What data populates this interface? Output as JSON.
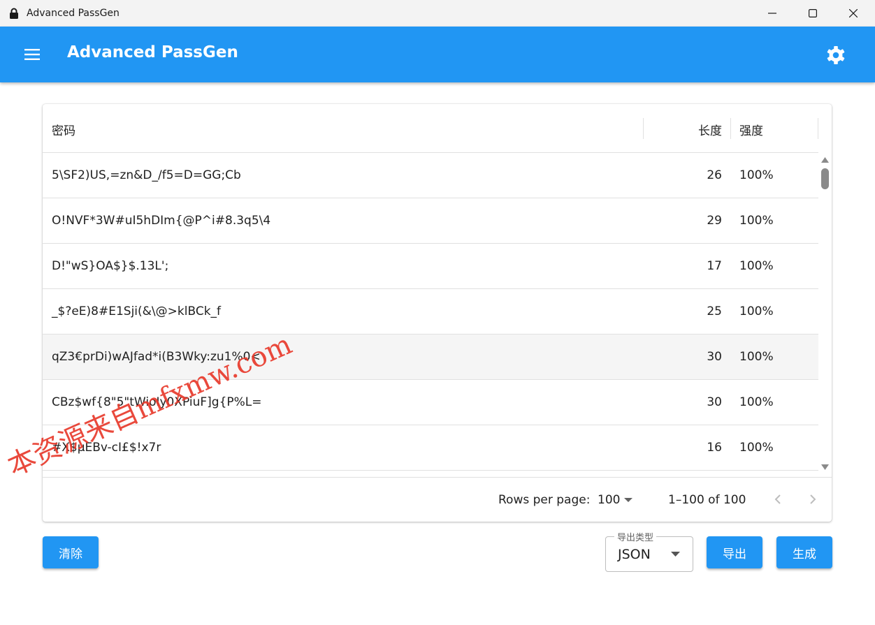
{
  "window": {
    "title": "Advanced PassGen",
    "controls": {
      "minimize": "minimize-icon",
      "maximize": "maximize-icon",
      "close": "close-icon"
    }
  },
  "appbar": {
    "title": "Advanced PassGen",
    "menu_icon": "hamburger-menu-icon",
    "settings_icon": "gear-icon",
    "color": "#2196f3"
  },
  "table": {
    "headers": {
      "password": "密码",
      "length": "长度",
      "strength": "强度"
    },
    "rows": [
      {
        "password": "5\\SF2)US,=zn&D_/f5=D=GG;Cb",
        "length": "26",
        "strength": "100%"
      },
      {
        "password": "O!NVF*3W#uI5hDIm{@P^i#8.3q5\\4",
        "length": "29",
        "strength": "100%"
      },
      {
        "password": "D!\"wS}OA$}$.13L';",
        "length": "17",
        "strength": "100%"
      },
      {
        "password": "_$?eE)8#E1Sji(&\\@>klBCk_f",
        "length": "25",
        "strength": "100%"
      },
      {
        "password": "qZ3€prDi)wAJfad*i(B3Wky:zu1%0<",
        "length": "30",
        "strength": "100%"
      },
      {
        "password": "CBz$wf{8\"5\"tWioIy0XPiuF]g{P%L=",
        "length": "30",
        "strength": "100%"
      },
      {
        "password": "#X$µEBv-cI£$!x7r",
        "length": "16",
        "strength": "100%"
      }
    ],
    "pagination": {
      "rows_per_page_label": "Rows per page:",
      "rows_per_page_value": "100",
      "range": "1–100 of 100"
    }
  },
  "actions": {
    "clear_label": "清除",
    "export_type_label": "导出类型",
    "export_type_value": "JSON",
    "export_label": "导出",
    "generate_label": "生成"
  },
  "watermark": "本资源来自mfxmw.com"
}
